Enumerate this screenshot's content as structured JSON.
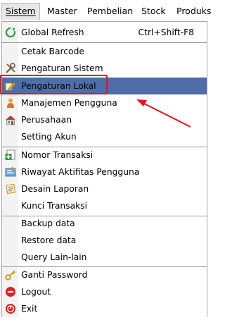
{
  "menubar": {
    "items": [
      {
        "label": "Sistem",
        "active": true
      },
      {
        "label": "Master"
      },
      {
        "label": "Pembelian"
      },
      {
        "label": "Stock"
      },
      {
        "label": "Produks"
      }
    ]
  },
  "dropdown": {
    "items": [
      {
        "label": "Global Refresh",
        "shortcut": "Ctrl+Shift-F8",
        "icon": "refresh-icon"
      },
      {
        "label": "Cetak Barcode"
      },
      {
        "label": "Pengaturan Sistem",
        "icon": "tools-icon"
      },
      {
        "label": "Pengaturan Lokal",
        "icon": "edit-pencil-icon",
        "selected": true
      },
      {
        "label": "Manajemen Pengguna",
        "icon": "user-icon"
      },
      {
        "label": "Perusahaan",
        "icon": "building-icon"
      },
      {
        "label": "Setting Akun"
      },
      {
        "label": "Nomor Transaksi",
        "icon": "add-document-icon"
      },
      {
        "label": "Riwayat Aktifitas Pengguna",
        "icon": "history-icon"
      },
      {
        "label": "Desain Laporan",
        "icon": "report-design-icon"
      },
      {
        "label": "Kunci Transaksi"
      },
      {
        "label": "Backup data"
      },
      {
        "label": "Restore data"
      },
      {
        "label": "Query Lain-lain"
      },
      {
        "label": "Ganti Password",
        "icon": "key-icon"
      },
      {
        "label": "Logout",
        "icon": "logout-icon"
      },
      {
        "label": "Exit",
        "icon": "exit-icon"
      }
    ]
  },
  "colors": {
    "selection": "#4f6da8",
    "highlight_annotation": "#e8141e"
  }
}
